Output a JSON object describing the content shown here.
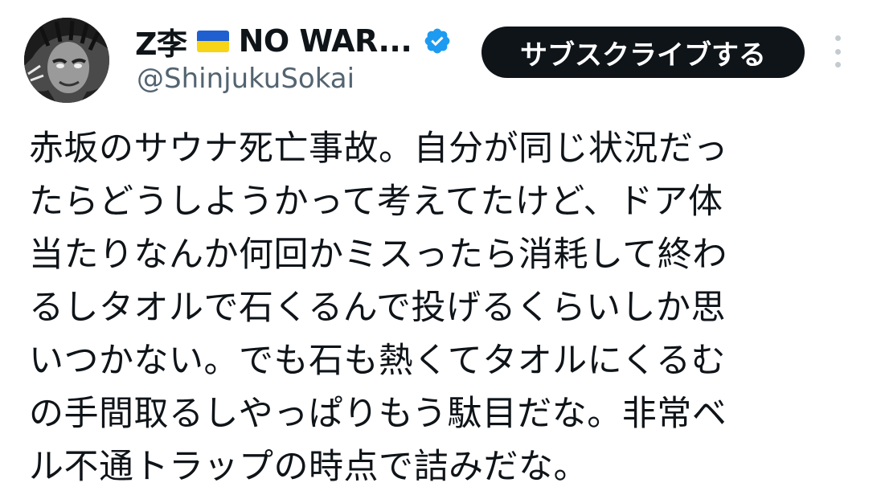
{
  "author": {
    "display_name_prefix": "Z李",
    "flag_icon": "ukraine-flag-icon",
    "display_name_suffix": "NO WAR...",
    "verified_icon": "verified-badge-icon",
    "handle": "@ShinjukuSokai"
  },
  "actions": {
    "subscribe_label": "サブスクライブする",
    "more_icon": "more-options-icon"
  },
  "tweet": {
    "lines": [
      "赤坂のサウナ死亡事故。自分が同じ状況だっ",
      "たらどうしようかって考えてたけど、ドア体",
      "当たりなんか何回かミスったら消耗して終わ",
      "るしタオルで石くるんで投げるくらいしか思",
      "いつかない。でも石も熱くてタオルにくるむ",
      "の手間取るしやっぱりもう駄目だな。非常ベ",
      "ル不通トラップの時点で詰みだな。"
    ]
  },
  "colors": {
    "text": "#0f1419",
    "secondary_text": "#536471",
    "verified": "#1d9bf0",
    "button_bg": "#0f1419",
    "button_text": "#ffffff"
  }
}
